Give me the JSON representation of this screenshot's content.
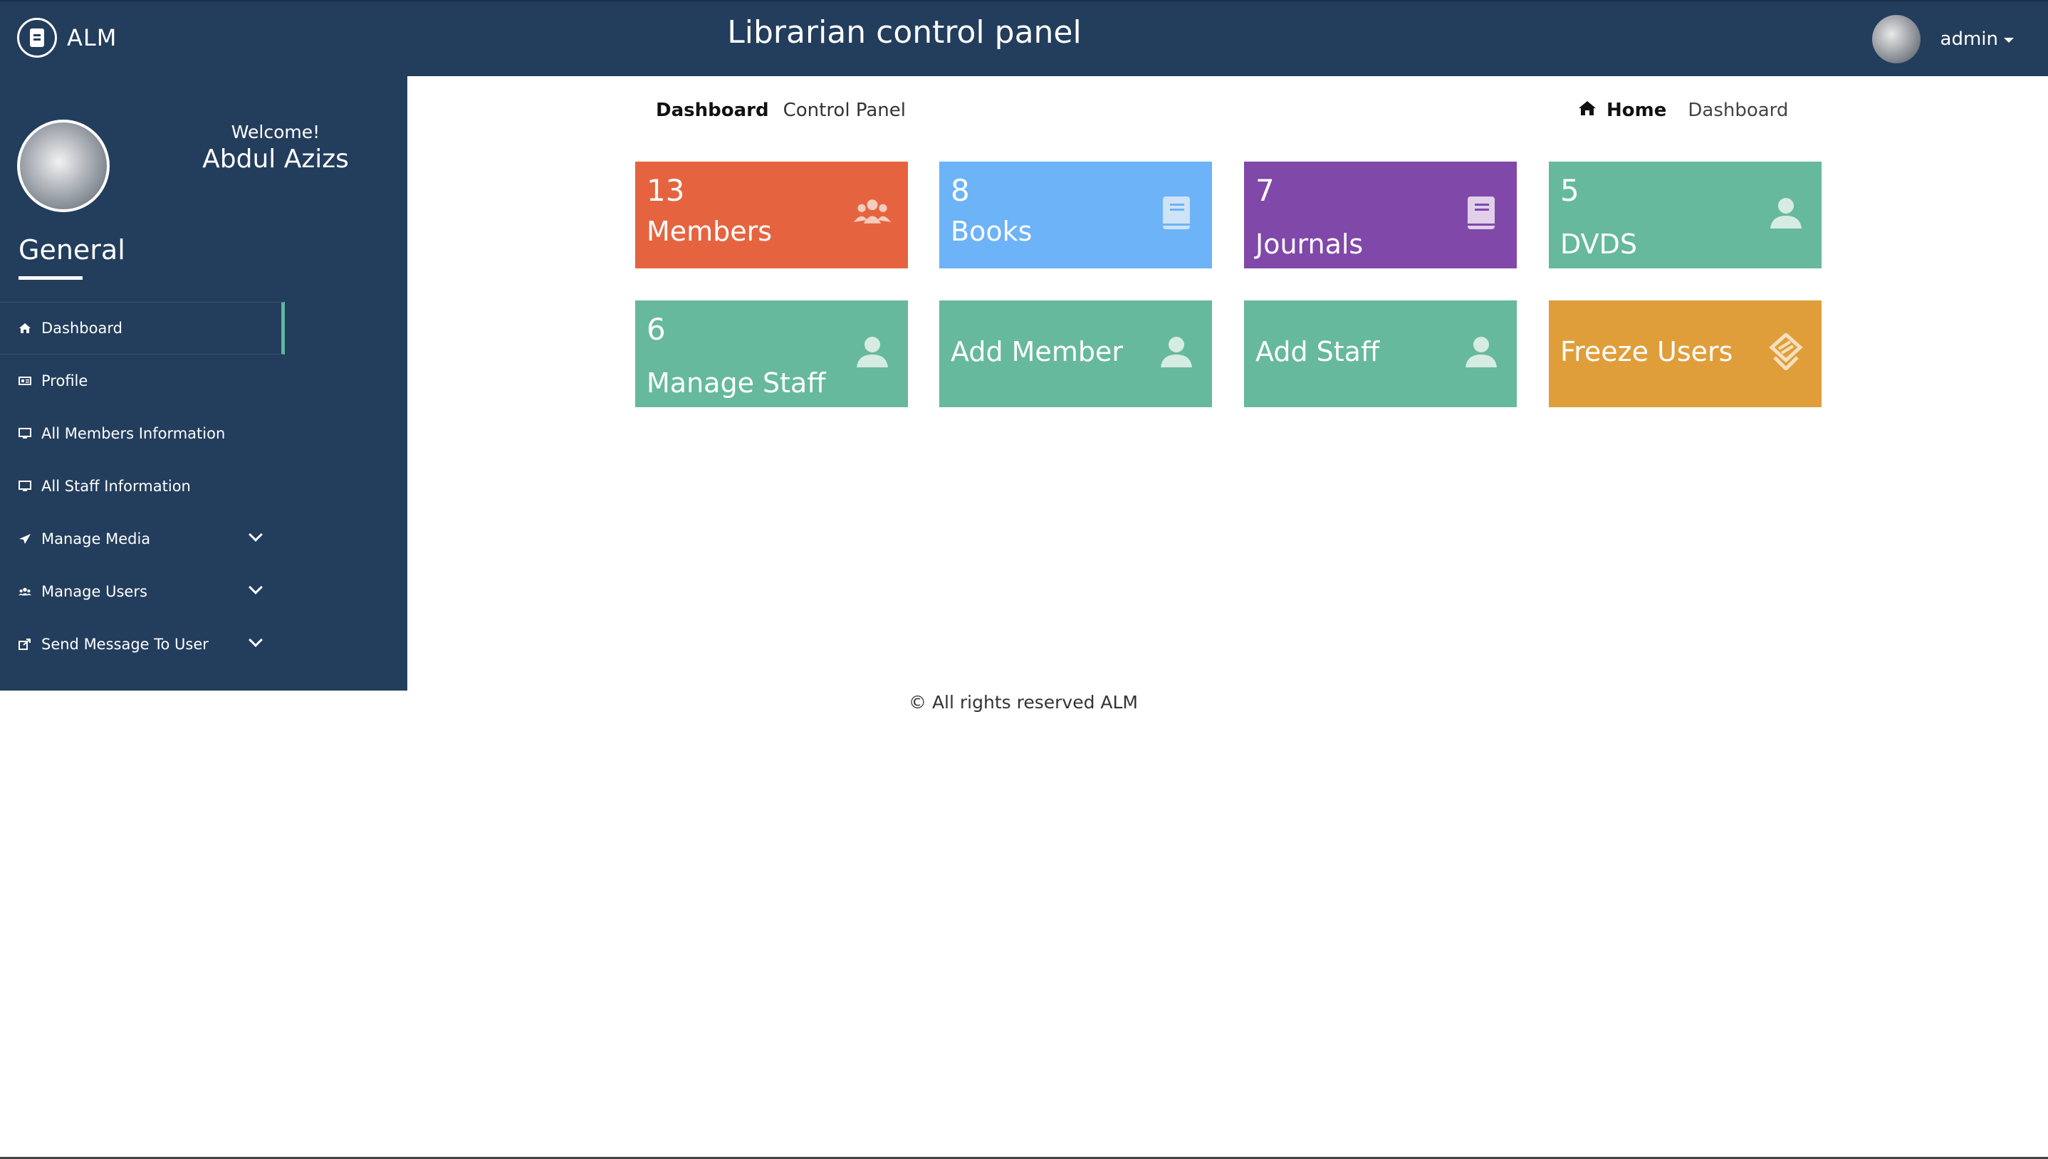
{
  "header": {
    "brand": "ALM",
    "title": "Librarian control panel",
    "user_label": "admin",
    "logo_icon": "book-icon",
    "avatar_icon": "user-avatar"
  },
  "sidebar": {
    "welcome": "Welcome!",
    "profile_name": "Abdul Azizs",
    "section_title": "General",
    "items": [
      {
        "label": "Dashboard",
        "icon": "home-icon",
        "active": true
      },
      {
        "label": "Profile",
        "icon": "id-card-icon"
      },
      {
        "label": "All Members Information",
        "icon": "monitor-icon"
      },
      {
        "label": "All Staff Information",
        "icon": "monitor-icon"
      },
      {
        "label": "Manage Media",
        "icon": "paper-plane-icon",
        "expandable": true
      },
      {
        "label": "Manage Users",
        "icon": "users-icon",
        "expandable": true
      },
      {
        "label": "Send Message To User",
        "icon": "share-icon",
        "expandable": true
      }
    ]
  },
  "breadcrumb": {
    "left_title": "Dashboard",
    "left_subtitle": "Control Panel",
    "home": "Home",
    "current": "Dashboard"
  },
  "tiles": [
    {
      "count": "13",
      "label": "Members",
      "color": "#e5643f",
      "icon": "users-group-icon"
    },
    {
      "count": "8",
      "label": "Books",
      "color": "#6cb3f7",
      "icon": "book-icon"
    },
    {
      "count": "7",
      "label": "Journals",
      "color": "#8048a8",
      "icon": "book-icon"
    },
    {
      "count": "5",
      "label": "DVDS",
      "color": "#66b99c",
      "icon": "user-icon"
    },
    {
      "count": "6",
      "label": "Manage Staff",
      "color": "#66b99c",
      "icon": "user-icon"
    },
    {
      "label": "Add Member",
      "color": "#66b99c",
      "icon": "user-icon"
    },
    {
      "label": "Add Staff",
      "color": "#66b99c",
      "icon": "user-icon"
    },
    {
      "label": "Freeze Users",
      "color": "#e09e3a",
      "icon": "layers-icon"
    }
  ],
  "footer": "© All rights reserved ALM"
}
